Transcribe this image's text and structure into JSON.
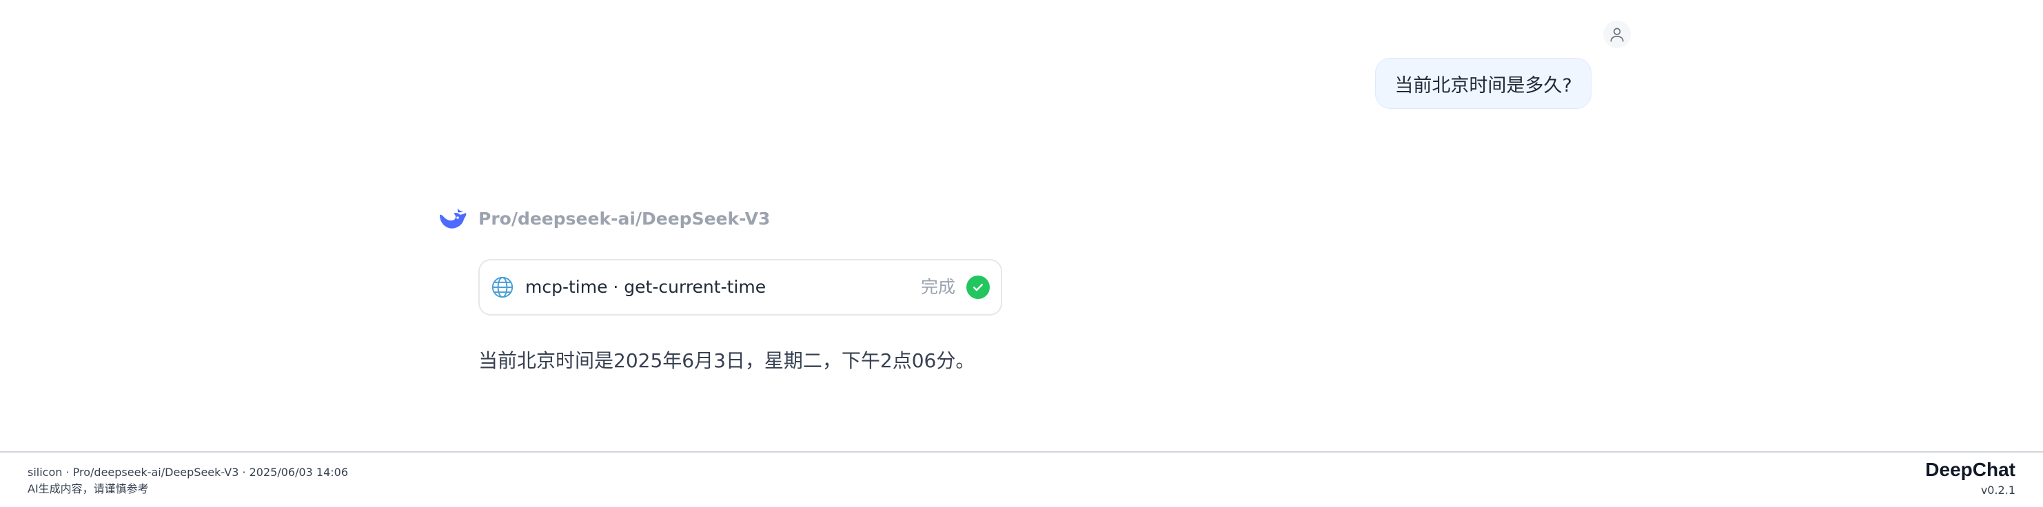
{
  "conversation": {
    "user_message": {
      "avatar_icon": "user-icon",
      "text": "当前北京时间是多久?"
    },
    "assistant_message": {
      "logo_icon": "deepseek-whale-icon",
      "model": "Pro/deepseek-ai/DeepSeek-V3",
      "tool_call": {
        "icon": "globe-icon",
        "name": "mcp-time · get-current-time",
        "status": "完成",
        "status_icon": "check-circle-icon",
        "status_color": "#22c55e"
      },
      "answer": "当前北京时间是2025年6月3日，星期二，下午2点06分。"
    }
  },
  "footer": {
    "meta": "silicon · Pro/deepseek-ai/DeepSeek-V3 · 2025/06/03 14:06",
    "disclaimer": "AI生成内容，请谨慎参考",
    "brand": "DeepChat",
    "version": "v0.2.1"
  },
  "colors": {
    "accent": "#4d6bfe",
    "user_bubble_bg": "#eff6ff",
    "muted_text": "#9ca3af"
  }
}
